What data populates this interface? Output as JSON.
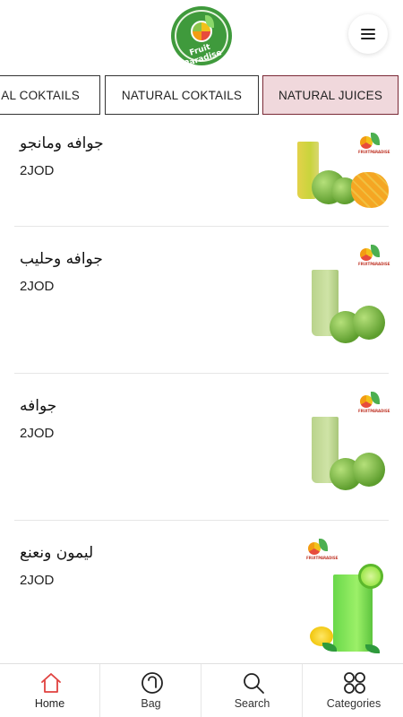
{
  "header": {
    "logo_text": "Fruit Paradise",
    "menu_icon": "hamburger-menu-icon"
  },
  "tabs": [
    {
      "label": "CIAL COKTAILS",
      "active": false
    },
    {
      "label": "NATURAL COKTAILS",
      "active": false
    },
    {
      "label": "NATURAL JUICES",
      "active": true
    }
  ],
  "products": [
    {
      "name": "جوافه ومانجو",
      "price": "2JOD",
      "image": "guava-mango-juice-image"
    },
    {
      "name": "جوافه وحليب",
      "price": "2JOD",
      "image": "guava-milk-juice-image"
    },
    {
      "name": "جوافه",
      "price": "2JOD",
      "image": "guava-juice-image"
    },
    {
      "name": "ليمون ونعنع",
      "price": "2JOD",
      "image": "lemon-mint-juice-image"
    }
  ],
  "bottom_nav": [
    {
      "label": "Home",
      "icon": "home-icon",
      "active": true
    },
    {
      "label": "Bag",
      "icon": "bag-icon",
      "active": false
    },
    {
      "label": "Search",
      "icon": "search-icon",
      "active": false
    },
    {
      "label": "Categories",
      "icon": "categories-icon",
      "active": false
    }
  ],
  "colors": {
    "active_tab_bg": "#f0d8dc",
    "active_tab_border": "#7a2a36",
    "home_icon_active": "#e0413f",
    "logo_green": "#3f9a3c"
  }
}
